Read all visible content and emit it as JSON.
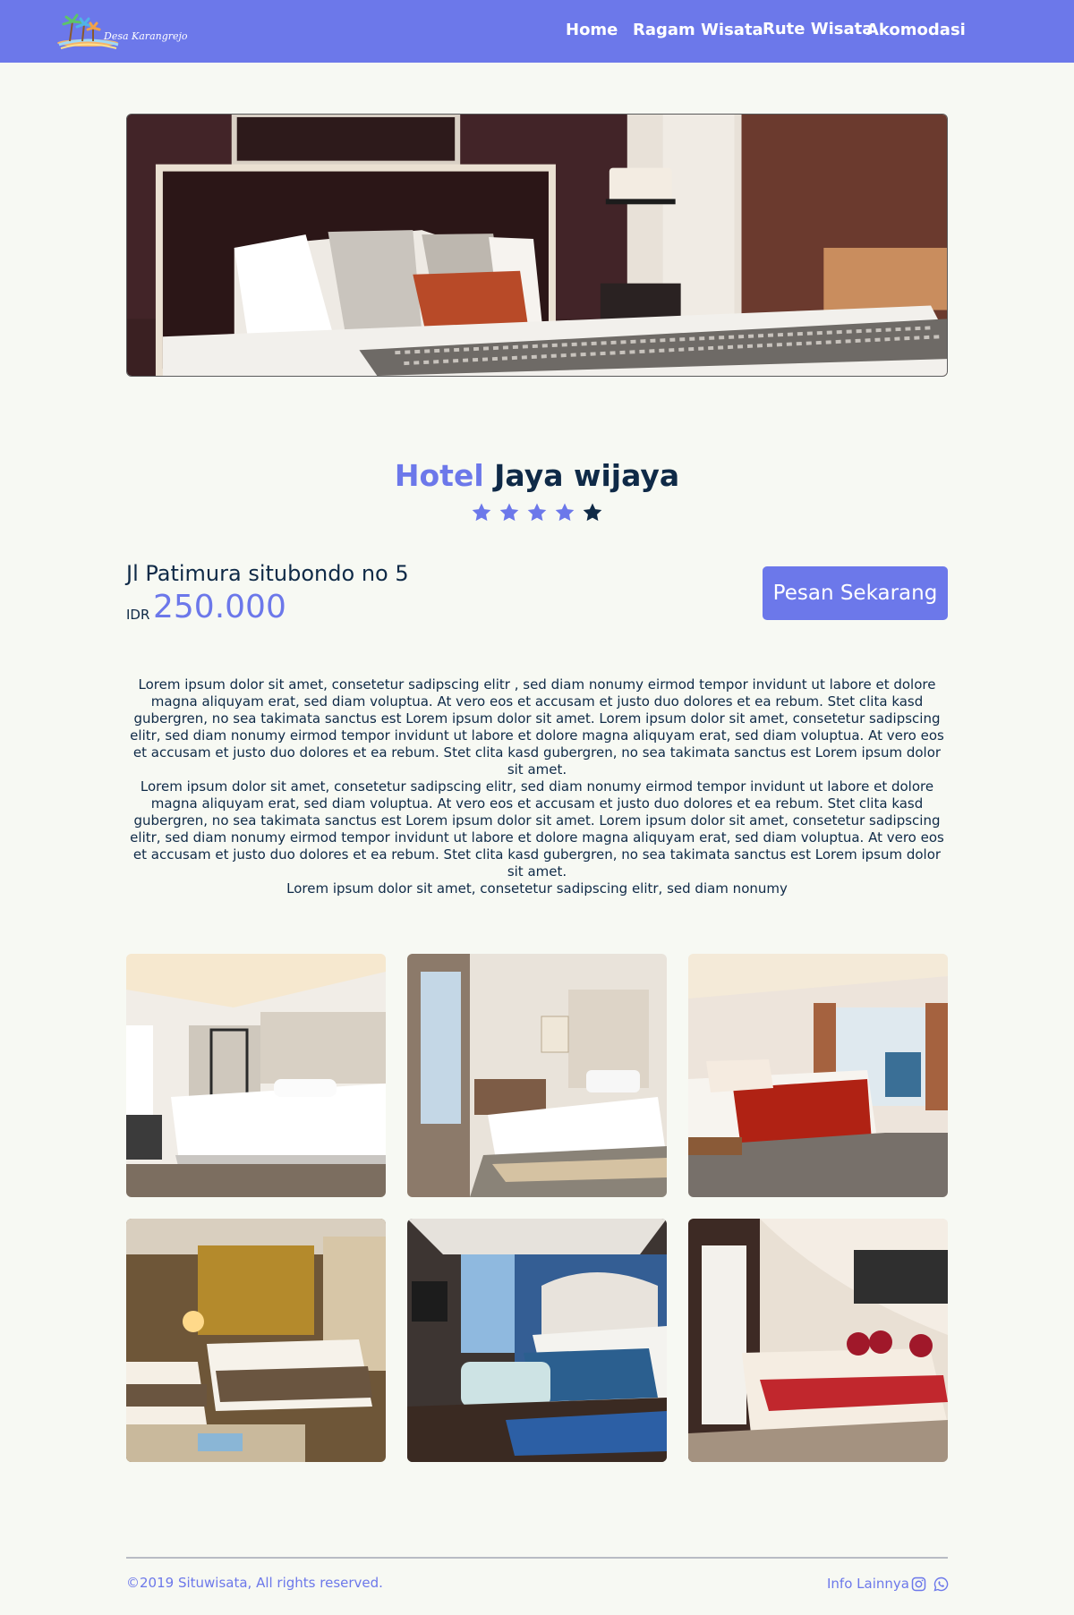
{
  "header": {
    "logo_text": "Desa Karangrejo",
    "nav": [
      "Home",
      "Ragam Wisata",
      "Rute Wisata",
      "Akomodasi"
    ]
  },
  "hotel": {
    "name_prefix": "Hotel",
    "name": "Jaya wijaya",
    "rating": 5,
    "address": "Jl Patimura situbondo no 5",
    "currency": "IDR",
    "price": "250.000",
    "book_label": "Pesan Sekarang"
  },
  "description": [
    "Lorem ipsum dolor sit amet, consetetur sadipscing elitr , sed diam nonumy eirmod tempor invidunt ut labore et dolore magna aliquyam erat, sed diam voluptua. At vero eos et accusam et justo duo dolores et ea rebum. Stet clita kasd gubergren, no sea takimata sanctus est Lorem ipsum dolor sit amet. Lorem ipsum dolor sit amet, consetetur sadipscing elitr, sed diam nonumy eirmod tempor invidunt ut labore et dolore magna aliquyam erat, sed diam voluptua. At vero eos et accusam et justo duo dolores et ea rebum. Stet clita kasd gubergren, no sea takimata sanctus est Lorem ipsum dolor sit amet.",
    "Lorem ipsum dolor sit amet, consetetur sadipscing elitr, sed diam nonumy eirmod tempor invidunt ut labore et dolore magna aliquyam erat, sed diam voluptua. At vero eos et accusam et justo duo dolores et ea rebum. Stet clita kasd gubergren, no sea takimata sanctus est Lorem ipsum dolor sit amet. Lorem ipsum dolor sit amet, consetetur sadipscing elitr, sed diam nonumy eirmod tempor invidunt ut labore et dolore magna aliquyam erat, sed diam voluptua. At vero eos et accusam et justo duo dolores et ea rebum. Stet clita kasd gubergren, no sea takimata sanctus est Lorem ipsum dolor sit amet.",
    "Lorem ipsum dolor sit amet, consetetur sadipscing elitr, sed diam nonumy"
  ],
  "footer": {
    "copyright": "©2019 Situwisata, All rights reserved.",
    "info_label": "Info Lainnya",
    "icons": [
      "instagram-icon",
      "whatsapp-icon"
    ]
  },
  "colors": {
    "accent": "#6c78ea",
    "text": "#0f2a47",
    "background": "#f7f9f3"
  }
}
